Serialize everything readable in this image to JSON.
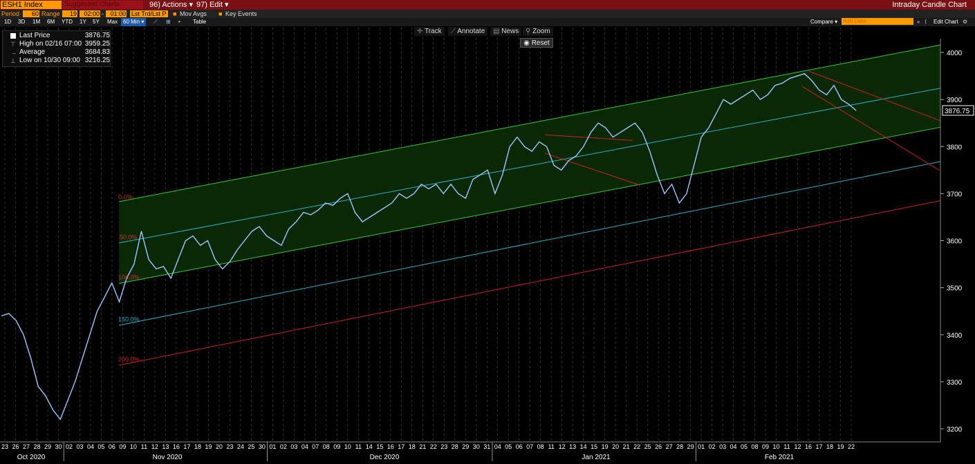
{
  "toolbar_top": {
    "ticker": "ESH1 Index",
    "suggested": "Suggested Charts",
    "actions": "96) Actions ▾",
    "edit": "97) Edit ▾",
    "title": "Intraday Candle Chart"
  },
  "toolbar_params": {
    "period_label": "Period",
    "period_value": "60",
    "range_label": "Range",
    "range_value": "19",
    "time_from": "02:00",
    "time_sep": "-",
    "time_to": "01:00",
    "trend": "Lst Trd/Lst P",
    "mov_avgs": "Mov Avgs",
    "key_events": "Key Events"
  },
  "toolbar_ranges": {
    "items": [
      "1D",
      "3D",
      "1M",
      "6M",
      "YTD",
      "1Y",
      "5Y",
      "Max"
    ],
    "interval": "60 Min ▾",
    "table": "Table",
    "compare": "Compare ▾",
    "add_data_placeholder": "Add Data",
    "edit_chart": "Edit Chart"
  },
  "chart_tools": {
    "track": "Track",
    "annotate": "Annotate",
    "news": "News",
    "zoom": "Zoom",
    "reset": "Reset"
  },
  "legend": {
    "rows": [
      {
        "label": "Last Price",
        "value": "3876.75"
      },
      {
        "label": "High on 02/16 07:00",
        "value": "3959.25"
      },
      {
        "label": "Average",
        "value": "3684.83"
      },
      {
        "label": "Low on 10/30 09:00",
        "value": "3216.25"
      }
    ]
  },
  "colors": {
    "accent_orange": "#ff9900",
    "title_bar": "#7a0f14",
    "channel_fill": "#0b2a06",
    "channel_line": "#33cc33",
    "mid_line": "#2ab0c8",
    "fib_red": "#cc2222",
    "price_line": "#9ec9ff"
  },
  "chart_data": {
    "type": "line",
    "title": "",
    "ylabel": "",
    "xlabel": "",
    "ylim": [
      3180,
      4040
    ],
    "y_ticks": [
      3200,
      3300,
      3400,
      3500,
      3600,
      3700,
      3800,
      3900,
      4000
    ],
    "y_tick_labels": [
      "3200",
      "3300",
      "3400",
      "3500",
      "3600",
      "3700",
      "3800",
      "3900",
      "4000"
    ],
    "last_price_label": "3876.75",
    "x_day_labels": [
      "23",
      "26",
      "27",
      "28",
      "29",
      "30",
      "02",
      "03",
      "04",
      "05",
      "06",
      "09",
      "10",
      "11",
      "12",
      "13",
      "16",
      "17",
      "18",
      "19",
      "20",
      "23",
      "24",
      "25",
      "30",
      "01",
      "02",
      "03",
      "04",
      "07",
      "08",
      "09",
      "10",
      "11",
      "14",
      "15",
      "16",
      "17",
      "18",
      "21",
      "22",
      "23",
      "28",
      "29",
      "30",
      "31",
      "04",
      "05",
      "06",
      "07",
      "08",
      "11",
      "12",
      "13",
      "14",
      "15",
      "19",
      "20",
      "21",
      "22",
      "25",
      "26",
      "27",
      "28",
      "29",
      "01",
      "02",
      "03",
      "04",
      "05",
      "08",
      "09",
      "10",
      "11",
      "12",
      "16",
      "17",
      "18",
      "19",
      "22"
    ],
    "x_month_labels": [
      "Oct 2020",
      "Nov 2020",
      "Dec 2020",
      "Jan 2021",
      "Feb 2021"
    ],
    "fib_labels": [
      "0.0%",
      "50.0%",
      "100.0%",
      "150.0%",
      "200.0%"
    ],
    "series": [
      {
        "values": [
          3440,
          3445,
          3430,
          3400,
          3350,
          3290,
          3270,
          3240,
          3220,
          3260,
          3300,
          3350,
          3400,
          3450,
          3480,
          3510,
          3470,
          3520,
          3550,
          3620,
          3560,
          3540,
          3545,
          3520,
          3560,
          3600,
          3610,
          3590,
          3600,
          3560,
          3540,
          3555,
          3580,
          3600,
          3620,
          3630,
          3610,
          3600,
          3590,
          3625,
          3640,
          3660,
          3655,
          3665,
          3680,
          3675,
          3690,
          3700,
          3660,
          3640,
          3650,
          3660,
          3670,
          3680,
          3700,
          3690,
          3700,
          3720,
          3710,
          3720,
          3700,
          3720,
          3700,
          3690,
          3730,
          3740,
          3750,
          3700,
          3740,
          3800,
          3820,
          3800,
          3790,
          3810,
          3800,
          3760,
          3750,
          3770,
          3780,
          3800,
          3830,
          3850,
          3840,
          3820,
          3830,
          3840,
          3850,
          3830,
          3790,
          3740,
          3700,
          3720,
          3680,
          3700,
          3760,
          3820,
          3840,
          3870,
          3900,
          3890,
          3900,
          3910,
          3920,
          3900,
          3910,
          3930,
          3935,
          3945,
          3950,
          3955,
          3940,
          3920,
          3910,
          3930,
          3900,
          3890,
          3876.75
        ]
      }
    ]
  }
}
